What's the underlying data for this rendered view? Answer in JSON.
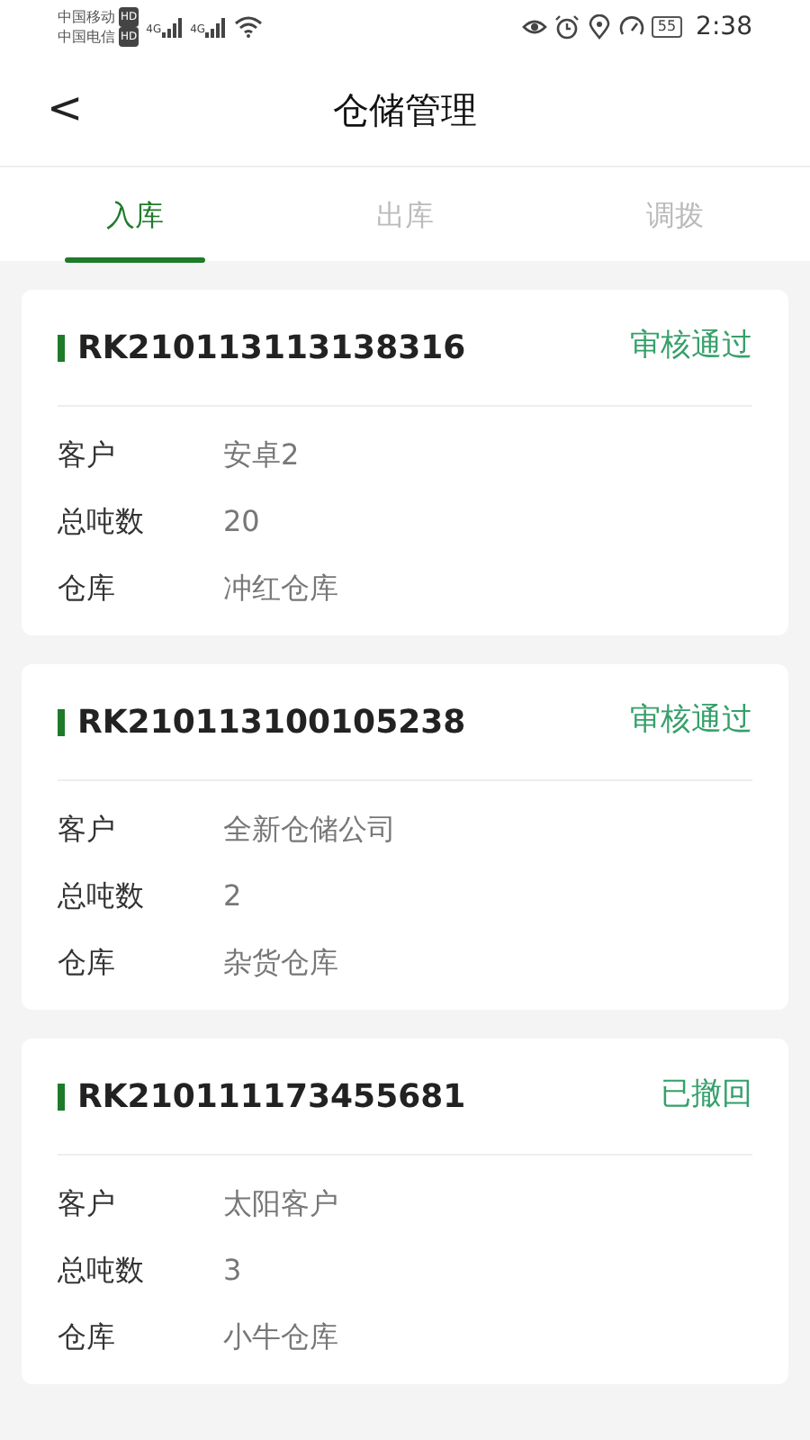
{
  "status_bar": {
    "carriers": [
      {
        "name": "中国移动",
        "badge": "HD",
        "network": "4G"
      },
      {
        "name": "中国电信",
        "badge": "HD",
        "network": "4G"
      }
    ],
    "battery": "55",
    "time": "2:38"
  },
  "header": {
    "back": "<",
    "title": "仓储管理"
  },
  "tabs": [
    {
      "label": "入库",
      "selected": true
    },
    {
      "label": "出库",
      "selected": false
    },
    {
      "label": "调拨",
      "selected": false
    }
  ],
  "records": [
    {
      "code": "RK210113113138316",
      "status": "审核通过",
      "fields": [
        {
          "label": "客户",
          "value": "安卓2"
        },
        {
          "label": "总吨数",
          "value": "20"
        },
        {
          "label": "仓库",
          "value": "冲红仓库"
        }
      ]
    },
    {
      "code": "RK210113100105238",
      "status": "审核通过",
      "fields": [
        {
          "label": "客户",
          "value": "全新仓储公司"
        },
        {
          "label": "总吨数",
          "value": "2"
        },
        {
          "label": "仓库",
          "value": "杂货仓库"
        }
      ]
    },
    {
      "code": "RK210111173455681",
      "status": "已撤回",
      "fields": [
        {
          "label": "客户",
          "value": "太阳客户"
        },
        {
          "label": "总吨数",
          "value": "3"
        },
        {
          "label": "仓库",
          "value": "小牛仓库"
        }
      ]
    }
  ]
}
